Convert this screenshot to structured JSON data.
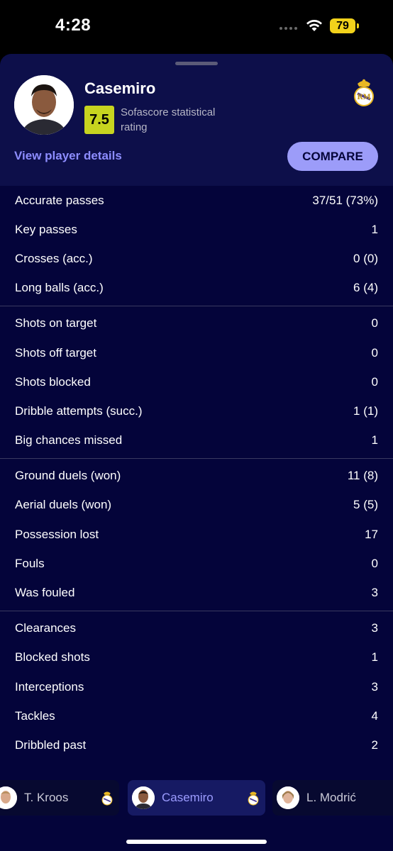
{
  "status_bar": {
    "time": "4:28",
    "battery": "79"
  },
  "header": {
    "player_name": "Casemiro",
    "rating": "7.5",
    "rating_label": "Sofascore statistical rating",
    "details_link": "View player details",
    "compare_label": "COMPARE",
    "club_logo_icon": "real-madrid-crest-icon",
    "colors": {
      "rating_bg": "#c7d41f",
      "accent": "#9c9cf9",
      "link": "#8d8dff"
    }
  },
  "stat_groups": [
    [
      {
        "label": "Accurate passes",
        "value": "37/51 (73%)"
      },
      {
        "label": "Key passes",
        "value": "1"
      },
      {
        "label": "Crosses (acc.)",
        "value": "0 (0)"
      },
      {
        "label": "Long balls (acc.)",
        "value": "6 (4)"
      }
    ],
    [
      {
        "label": "Shots on target",
        "value": "0"
      },
      {
        "label": "Shots off target",
        "value": "0"
      },
      {
        "label": "Shots blocked",
        "value": "0"
      },
      {
        "label": "Dribble attempts (succ.)",
        "value": "1 (1)"
      },
      {
        "label": "Big chances missed",
        "value": "1"
      }
    ],
    [
      {
        "label": "Ground duels (won)",
        "value": "11 (8)"
      },
      {
        "label": "Aerial duels (won)",
        "value": "5 (5)"
      },
      {
        "label": "Possession lost",
        "value": "17"
      },
      {
        "label": "Fouls",
        "value": "0"
      },
      {
        "label": "Was fouled",
        "value": "3"
      }
    ],
    [
      {
        "label": "Clearances",
        "value": "3"
      },
      {
        "label": "Blocked shots",
        "value": "1"
      },
      {
        "label": "Interceptions",
        "value": "3"
      },
      {
        "label": "Tackles",
        "value": "4"
      },
      {
        "label": "Dribbled past",
        "value": "2"
      }
    ]
  ],
  "switcher": [
    {
      "name": "T. Kroos",
      "active": false
    },
    {
      "name": "Casemiro",
      "active": true
    },
    {
      "name": "L. Modrić",
      "active": false
    }
  ]
}
